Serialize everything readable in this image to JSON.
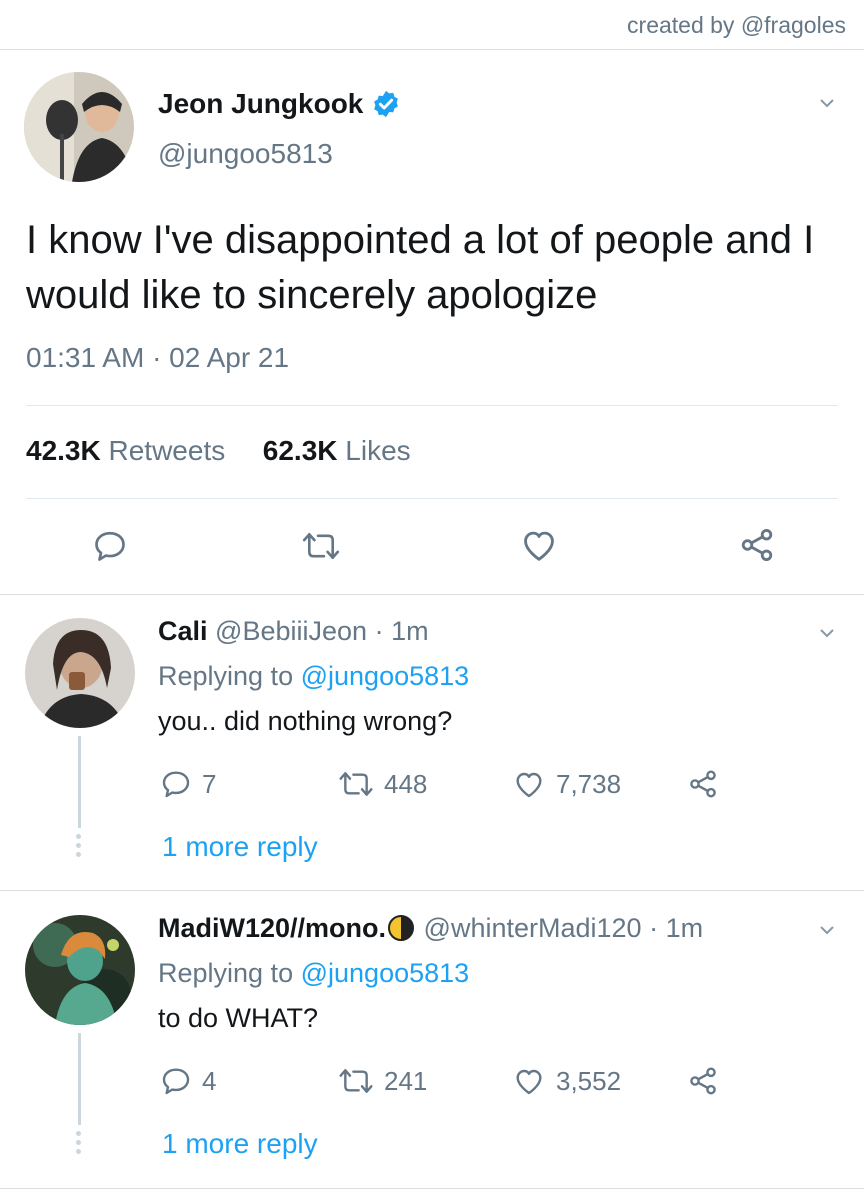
{
  "credit": "created by @fragoles",
  "colors": {
    "accent": "#1da1f2",
    "muted": "#657786",
    "text": "#14171a",
    "divider": "#e1e8ed"
  },
  "main_tweet": {
    "name": "Jeon Jungkook",
    "verified": true,
    "handle": "@jungoo5813",
    "text": "I know I've disappointed a lot of people and I would like to sincerely apologize",
    "timestamp": "01:31 AM · 02 Apr 21",
    "retweets_count": "42.3K",
    "retweets_label": "Retweets",
    "likes_count": "62.3K",
    "likes_label": "Likes"
  },
  "replies": [
    {
      "name": "Cali",
      "handle": "@BebiiiJeon",
      "time": "1m",
      "replying_prefix": "Replying to",
      "replying_handle": "@jungoo5813",
      "text": "you.. did nothing wrong?",
      "reply_count": "7",
      "retweet_count": "448",
      "like_count": "7,738",
      "more_reply": "1 more reply"
    },
    {
      "name": "MadiW120//mono.",
      "handle": "@whinterMadi120",
      "time": "1m",
      "replying_prefix": "Replying to",
      "replying_handle": "@jungoo5813",
      "text": "to do WHAT?",
      "reply_count": "4",
      "retweet_count": "241",
      "like_count": "3,552",
      "more_reply": "1 more reply"
    }
  ]
}
